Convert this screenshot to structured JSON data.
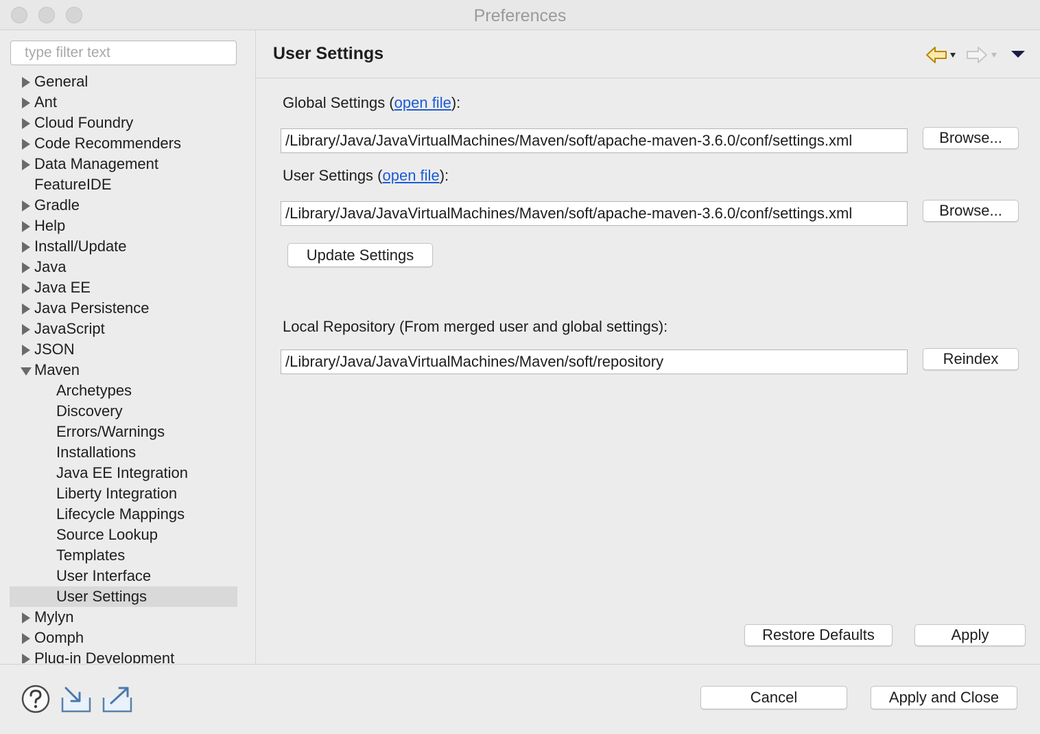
{
  "window": {
    "title": "Preferences"
  },
  "filter": {
    "placeholder": "type filter text"
  },
  "tree": [
    {
      "label": "General",
      "state": "collapsed"
    },
    {
      "label": "Ant",
      "state": "collapsed"
    },
    {
      "label": "Cloud Foundry",
      "state": "collapsed"
    },
    {
      "label": "Code Recommenders",
      "state": "collapsed"
    },
    {
      "label": "Data Management",
      "state": "collapsed"
    },
    {
      "label": "FeatureIDE",
      "state": "leaf"
    },
    {
      "label": "Gradle",
      "state": "collapsed"
    },
    {
      "label": "Help",
      "state": "collapsed"
    },
    {
      "label": "Install/Update",
      "state": "collapsed"
    },
    {
      "label": "Java",
      "state": "collapsed"
    },
    {
      "label": "Java EE",
      "state": "collapsed"
    },
    {
      "label": "Java Persistence",
      "state": "collapsed"
    },
    {
      "label": "JavaScript",
      "state": "collapsed"
    },
    {
      "label": "JSON",
      "state": "collapsed"
    },
    {
      "label": "Maven",
      "state": "expanded"
    },
    {
      "label": "Archetypes",
      "state": "child"
    },
    {
      "label": "Discovery",
      "state": "child"
    },
    {
      "label": "Errors/Warnings",
      "state": "child"
    },
    {
      "label": "Installations",
      "state": "child"
    },
    {
      "label": "Java EE Integration",
      "state": "child"
    },
    {
      "label": "Liberty Integration",
      "state": "child"
    },
    {
      "label": "Lifecycle Mappings",
      "state": "child"
    },
    {
      "label": "Source Lookup",
      "state": "child"
    },
    {
      "label": "Templates",
      "state": "child"
    },
    {
      "label": "User Interface",
      "state": "child"
    },
    {
      "label": "User Settings",
      "state": "child",
      "selected": true
    },
    {
      "label": "Mylyn",
      "state": "collapsed"
    },
    {
      "label": "Oomph",
      "state": "collapsed"
    },
    {
      "label": "Plug-in Development",
      "state": "collapsed"
    }
  ],
  "page": {
    "title": "User Settings",
    "global": {
      "label_prefix": "Global Settings (",
      "link": "open file",
      "label_suffix": "):",
      "value": "/Library/Java/JavaVirtualMachines/Maven/soft/apache-maven-3.6.0/conf/settings.xml",
      "browse": "Browse..."
    },
    "user": {
      "label_prefix": "User Settings (",
      "link": "open file",
      "label_suffix": "):",
      "value": "/Library/Java/JavaVirtualMachines/Maven/soft/apache-maven-3.6.0/conf/settings.xml",
      "browse": "Browse..."
    },
    "update_settings": "Update Settings",
    "local_repo": {
      "label": "Local Repository (From merged user and global settings):",
      "value": "/Library/Java/JavaVirtualMachines/Maven/soft/repository",
      "reindex": "Reindex"
    },
    "restore_defaults": "Restore Defaults",
    "apply": "Apply"
  },
  "footer": {
    "cancel": "Cancel",
    "apply_and_close": "Apply and Close",
    "icons": [
      "help-icon",
      "import-icon",
      "export-icon"
    ]
  },
  "colors": {
    "link": "#1d5bd6",
    "selection": "#d9d9d9",
    "back_arrow": "#c9a227"
  }
}
